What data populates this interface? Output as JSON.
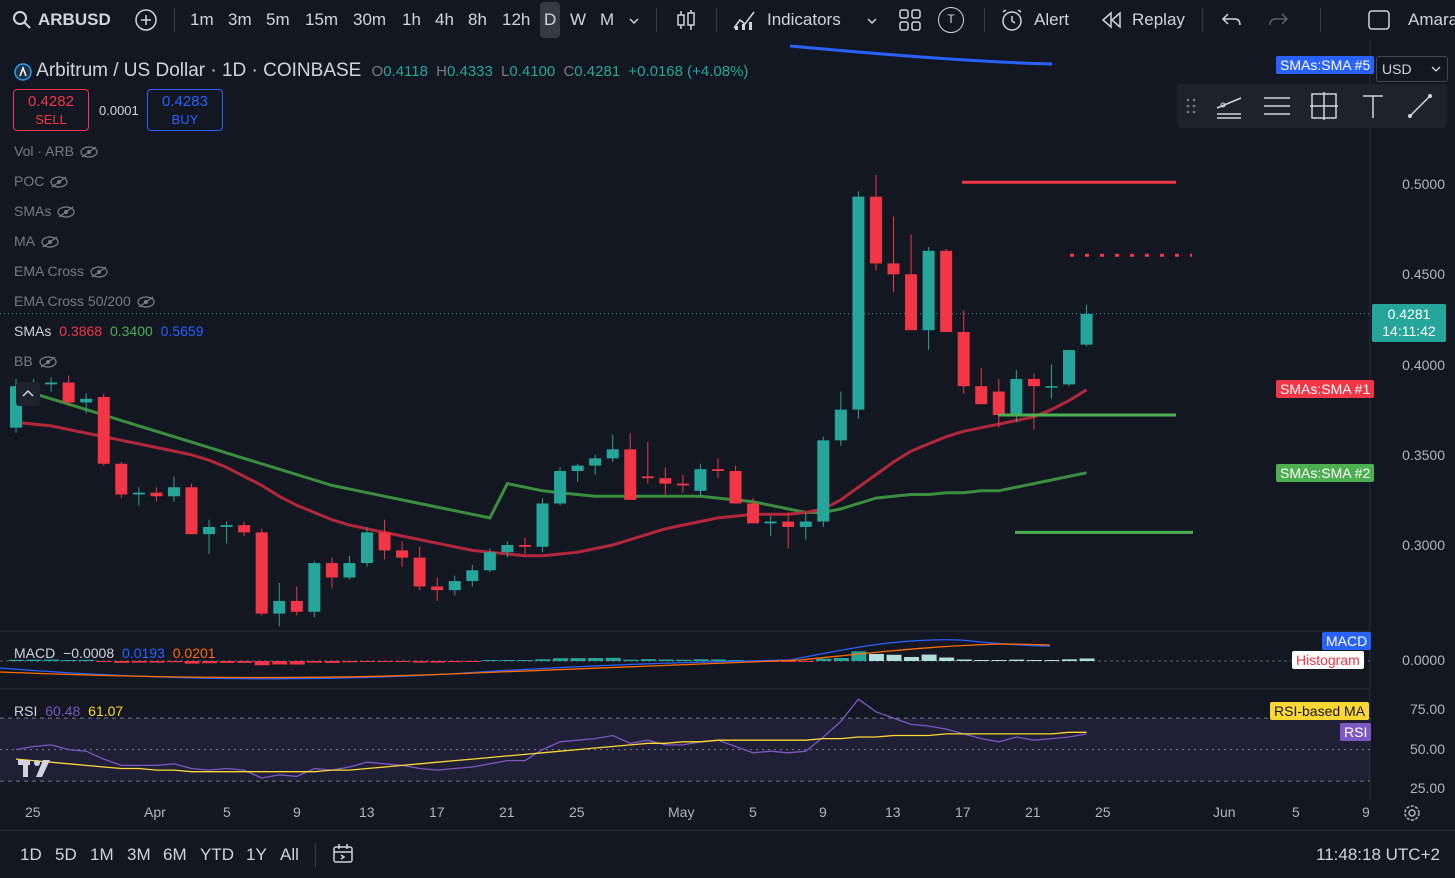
{
  "toolbar": {
    "symbol": "ARBUSD",
    "intervals": [
      "1m",
      "3m",
      "5m",
      "15m",
      "30m",
      "1h",
      "4h",
      "8h",
      "12h",
      "D",
      "W",
      "M"
    ],
    "selected_interval": "D",
    "indicators_label": "Indicators",
    "alert_label": "Alert",
    "replay_label": "Replay",
    "user_label": "Amara",
    "t_badge": "T"
  },
  "header": {
    "title": "Arbitrum / US Dollar · 1D · COINBASE",
    "o_label": "O",
    "o_val": "0.4118",
    "h_label": "H",
    "h_val": "0.4333",
    "l_label": "L",
    "l_val": "0.4100",
    "c_label": "C",
    "c_val": "0.4281",
    "change": "+0.0168 (+4.08%)",
    "currency": "USD"
  },
  "trade": {
    "sell_price": "0.4282",
    "sell_label": "SELL",
    "spread": "0.0001",
    "buy_price": "0.4283",
    "buy_label": "BUY"
  },
  "indicators": [
    {
      "label": "Vol · ARB"
    },
    {
      "label": "POC"
    },
    {
      "label": "SMAs"
    },
    {
      "label": "MA"
    },
    {
      "label": "EMA Cross"
    },
    {
      "label": "EMA Cross 50/200"
    }
  ],
  "smas_legend": {
    "label": "SMAs",
    "v1": "0.3868",
    "v2": "0.3400",
    "v3": "0.5659"
  },
  "bb_label": "BB",
  "price_axis": [
    "0.5000",
    "0.4500",
    "0.4000",
    "0.3500",
    "0.3000"
  ],
  "last_price": {
    "value": "0.4281",
    "countdown": "14:11:42"
  },
  "tags": {
    "sma5": "SMAs:SMA #5",
    "sma1": "SMAs:SMA #1",
    "sma2": "SMAs:SMA #2",
    "macd": "MACD",
    "histogram": "Histogram",
    "rsi_ma": "RSI-based MA",
    "rsi": "RSI"
  },
  "macd": {
    "label": "MACD",
    "v1": "−0.0008",
    "v2": "0.0193",
    "v3": "0.0201",
    "axis": "0.0000"
  },
  "rsi": {
    "label": "RSI",
    "v1": "60.48",
    "v2": "61.07",
    "axis": [
      "75.00",
      "50.00",
      "25.00"
    ]
  },
  "x_axis": [
    "25",
    "Apr",
    "5",
    "9",
    "13",
    "17",
    "21",
    "25",
    "May",
    "5",
    "9",
    "13",
    "17",
    "21",
    "25",
    "Jun",
    "5",
    "9"
  ],
  "bottom": {
    "ranges": [
      "1D",
      "5D",
      "1M",
      "3M",
      "6M",
      "YTD",
      "1Y",
      "All"
    ],
    "clock": "11:48:18 UTC+2"
  },
  "colors": {
    "up": "#26a69a",
    "down": "#f23645",
    "sma1": "#b2283a",
    "sma2": "#3a8f3e",
    "sma5": "#2962ff"
  },
  "chart_data": {
    "type": "candlestick",
    "candles": [
      [
        0.365,
        0.392,
        0.362,
        0.388
      ],
      [
        0.388,
        0.392,
        0.382,
        0.389
      ],
      [
        0.389,
        0.393,
        0.385,
        0.39
      ],
      [
        0.39,
        0.394,
        0.377,
        0.379
      ],
      [
        0.379,
        0.384,
        0.373,
        0.381
      ],
      [
        0.382,
        0.384,
        0.344,
        0.345
      ],
      [
        0.345,
        0.346,
        0.326,
        0.328
      ],
      [
        0.328,
        0.332,
        0.322,
        0.329
      ],
      [
        0.329,
        0.332,
        0.324,
        0.327
      ],
      [
        0.327,
        0.338,
        0.324,
        0.332
      ],
      [
        0.332,
        0.334,
        0.306,
        0.306
      ],
      [
        0.306,
        0.314,
        0.295,
        0.31
      ],
      [
        0.31,
        0.313,
        0.301,
        0.311
      ],
      [
        0.311,
        0.313,
        0.305,
        0.307
      ],
      [
        0.307,
        0.309,
        0.261,
        0.262
      ],
      [
        0.262,
        0.279,
        0.255,
        0.269
      ],
      [
        0.269,
        0.277,
        0.261,
        0.263
      ],
      [
        0.263,
        0.291,
        0.26,
        0.29
      ],
      [
        0.29,
        0.293,
        0.276,
        0.282
      ],
      [
        0.282,
        0.294,
        0.281,
        0.29
      ],
      [
        0.29,
        0.31,
        0.288,
        0.307
      ],
      [
        0.307,
        0.314,
        0.292,
        0.297
      ],
      [
        0.297,
        0.302,
        0.288,
        0.293
      ],
      [
        0.293,
        0.299,
        0.275,
        0.277
      ],
      [
        0.277,
        0.282,
        0.269,
        0.275
      ],
      [
        0.275,
        0.283,
        0.272,
        0.28
      ],
      [
        0.28,
        0.289,
        0.277,
        0.286
      ],
      [
        0.286,
        0.298,
        0.285,
        0.296
      ],
      [
        0.296,
        0.302,
        0.293,
        0.3
      ],
      [
        0.3,
        0.304,
        0.295,
        0.299
      ],
      [
        0.299,
        0.326,
        0.296,
        0.323
      ],
      [
        0.323,
        0.343,
        0.322,
        0.341
      ],
      [
        0.341,
        0.345,
        0.335,
        0.344
      ],
      [
        0.344,
        0.35,
        0.339,
        0.348
      ],
      [
        0.348,
        0.361,
        0.346,
        0.353
      ],
      [
        0.353,
        0.362,
        0.351,
        0.325
      ],
      [
        0.338,
        0.357,
        0.334,
        0.337
      ],
      [
        0.337,
        0.343,
        0.328,
        0.334
      ],
      [
        0.334,
        0.339,
        0.329,
        0.333
      ],
      [
        0.33,
        0.345,
        0.327,
        0.342
      ],
      [
        0.342,
        0.348,
        0.337,
        0.341
      ],
      [
        0.341,
        0.344,
        0.323,
        0.323
      ],
      [
        0.323,
        0.326,
        0.312,
        0.312
      ],
      [
        0.312,
        0.316,
        0.305,
        0.313
      ],
      [
        0.313,
        0.318,
        0.298,
        0.31
      ],
      [
        0.31,
        0.318,
        0.303,
        0.313
      ],
      [
        0.313,
        0.36,
        0.31,
        0.358
      ],
      [
        0.358,
        0.385,
        0.355,
        0.375
      ],
      [
        0.375,
        0.496,
        0.37,
        0.493
      ],
      [
        0.493,
        0.505,
        0.452,
        0.456
      ],
      [
        0.456,
        0.482,
        0.44,
        0.45
      ],
      [
        0.45,
        0.472,
        0.419,
        0.419
      ],
      [
        0.419,
        0.465,
        0.408,
        0.463
      ],
      [
        0.463,
        0.464,
        0.418,
        0.418
      ],
      [
        0.418,
        0.43,
        0.384,
        0.388
      ],
      [
        0.388,
        0.398,
        0.38,
        0.378
      ],
      [
        0.385,
        0.392,
        0.365,
        0.372
      ],
      [
        0.372,
        0.397,
        0.368,
        0.392
      ],
      [
        0.392,
        0.395,
        0.364,
        0.388
      ],
      [
        0.388,
        0.4,
        0.381,
        0.388
      ],
      [
        0.389,
        0.408,
        0.388,
        0.408
      ],
      [
        0.411,
        0.433,
        0.41,
        0.428
      ]
    ],
    "sma1": [
      0.368,
      0.367,
      0.366,
      0.364,
      0.362,
      0.36,
      0.358,
      0.356,
      0.354,
      0.352,
      0.35,
      0.347,
      0.343,
      0.338,
      0.333,
      0.327,
      0.322,
      0.318,
      0.314,
      0.311,
      0.309,
      0.307,
      0.305,
      0.303,
      0.301,
      0.299,
      0.297,
      0.296,
      0.295,
      0.294,
      0.294,
      0.295,
      0.296,
      0.298,
      0.3,
      0.303,
      0.306,
      0.309,
      0.311,
      0.313,
      0.315,
      0.316,
      0.317,
      0.317,
      0.317,
      0.318,
      0.32,
      0.325,
      0.332,
      0.339,
      0.346,
      0.352,
      0.356,
      0.36,
      0.363,
      0.365,
      0.367,
      0.369,
      0.371,
      0.375,
      0.38,
      0.386
    ],
    "sma2": [
      0.387,
      0.384,
      0.381,
      0.378,
      0.375,
      0.372,
      0.369,
      0.366,
      0.363,
      0.36,
      0.357,
      0.354,
      0.351,
      0.348,
      0.345,
      0.342,
      0.339,
      0.336,
      0.333,
      0.331,
      0.329,
      0.327,
      0.325,
      0.323,
      0.321,
      0.319,
      0.317,
      0.315,
      0.334,
      0.332,
      0.33,
      0.329,
      0.328,
      0.327,
      0.327,
      0.327,
      0.327,
      0.327,
      0.327,
      0.327,
      0.326,
      0.325,
      0.324,
      0.322,
      0.32,
      0.318,
      0.318,
      0.32,
      0.323,
      0.326,
      0.327,
      0.328,
      0.328,
      0.329,
      0.329,
      0.33,
      0.33,
      0.332,
      0.334,
      0.336,
      0.338,
      0.34
    ],
    "rsi": [
      50,
      52,
      53,
      50,
      49,
      44,
      40,
      40,
      40,
      41,
      38,
      37,
      38,
      37,
      32,
      34,
      33,
      38,
      37,
      39,
      42,
      41,
      40,
      38,
      37,
      38,
      39,
      41,
      43,
      43,
      50,
      55,
      56,
      57,
      59,
      54,
      56,
      53,
      53,
      55,
      56,
      52,
      48,
      49,
      48,
      49,
      58,
      68,
      82,
      74,
      70,
      66,
      65,
      63,
      60,
      57,
      55,
      58,
      56,
      57,
      58,
      60
    ],
    "rsi_ma": [
      44,
      43,
      42,
      41,
      40,
      39,
      38,
      38,
      37,
      37,
      36,
      36,
      36,
      36,
      36,
      36,
      36,
      36,
      37,
      37,
      38,
      39,
      40,
      41,
      42,
      43,
      44,
      45,
      46,
      47,
      48,
      49,
      50,
      51,
      52,
      53,
      54,
      54,
      55,
      55,
      56,
      56,
      56,
      56,
      56,
      56,
      57,
      57,
      58,
      58,
      59,
      59,
      59,
      60,
      60,
      60,
      60,
      60,
      60,
      60,
      61,
      61
    ]
  }
}
